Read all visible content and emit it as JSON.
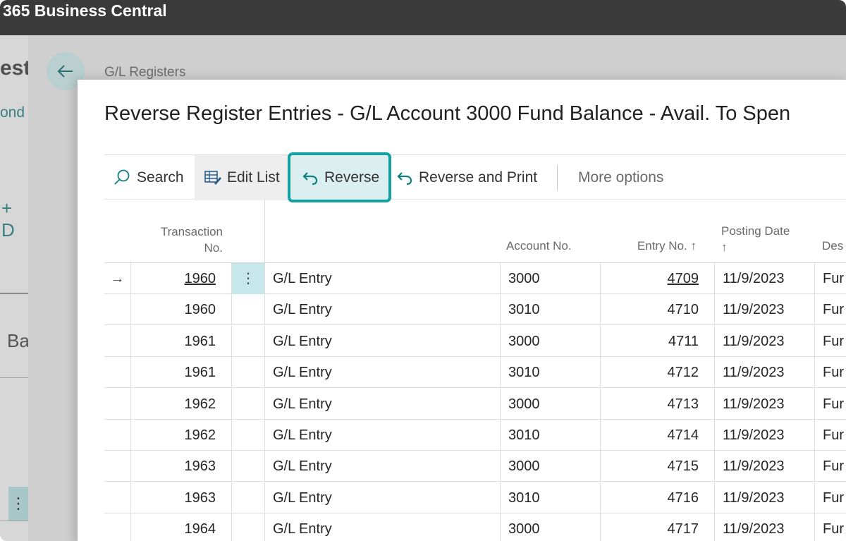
{
  "app": {
    "title": "365 Business Central"
  },
  "background": {
    "breadcrumb": "G/L Registers",
    "left_fragments": [
      "est",
      "ond",
      "+ D",
      "Ba",
      "⋮"
    ]
  },
  "dialog": {
    "title": "Reverse Register Entries - G/L Account 3000 Fund Balance - Avail. To Spen"
  },
  "actions": {
    "search": "Search",
    "edit_list": "Edit List",
    "reverse": "Reverse",
    "reverse_and_print": "Reverse and Print",
    "more_options": "More options"
  },
  "table": {
    "headers": {
      "transaction_no_line1": "Transaction",
      "transaction_no_line2": "No.",
      "account_no": "Account No.",
      "entry_no": "Entry No. ↑",
      "posting_date_line1": "Posting Date",
      "posting_date_line2": "↑",
      "description": "Des"
    },
    "rows": [
      {
        "pointer": "→",
        "transaction_no": "1960",
        "menu": "⋮",
        "type": "G/L Entry",
        "account_no": "3000",
        "entry_no": "4709",
        "posting_date": "11/9/2023",
        "description": "Fur"
      },
      {
        "pointer": "",
        "transaction_no": "1960",
        "menu": "",
        "type": "G/L Entry",
        "account_no": "3010",
        "entry_no": "4710",
        "posting_date": "11/9/2023",
        "description": "Fur"
      },
      {
        "pointer": "",
        "transaction_no": "1961",
        "menu": "",
        "type": "G/L Entry",
        "account_no": "3000",
        "entry_no": "4711",
        "posting_date": "11/9/2023",
        "description": "Fur"
      },
      {
        "pointer": "",
        "transaction_no": "1961",
        "menu": "",
        "type": "G/L Entry",
        "account_no": "3010",
        "entry_no": "4712",
        "posting_date": "11/9/2023",
        "description": "Fur"
      },
      {
        "pointer": "",
        "transaction_no": "1962",
        "menu": "",
        "type": "G/L Entry",
        "account_no": "3000",
        "entry_no": "4713",
        "posting_date": "11/9/2023",
        "description": "Fur"
      },
      {
        "pointer": "",
        "transaction_no": "1962",
        "menu": "",
        "type": "G/L Entry",
        "account_no": "3010",
        "entry_no": "4714",
        "posting_date": "11/9/2023",
        "description": "Fur"
      },
      {
        "pointer": "",
        "transaction_no": "1963",
        "menu": "",
        "type": "G/L Entry",
        "account_no": "3000",
        "entry_no": "4715",
        "posting_date": "11/9/2023",
        "description": "Fur"
      },
      {
        "pointer": "",
        "transaction_no": "1963",
        "menu": "",
        "type": "G/L Entry",
        "account_no": "3010",
        "entry_no": "4716",
        "posting_date": "11/9/2023",
        "description": "Fur"
      },
      {
        "pointer": "",
        "transaction_no": "1964",
        "menu": "",
        "type": "G/L Entry",
        "account_no": "3000",
        "entry_no": "4717",
        "posting_date": "11/9/2023",
        "description": "Fur"
      }
    ]
  },
  "colors": {
    "accent": "#14a1a1",
    "topbar": "#3a3a3a",
    "selected_button_bg": "#dceff0"
  }
}
